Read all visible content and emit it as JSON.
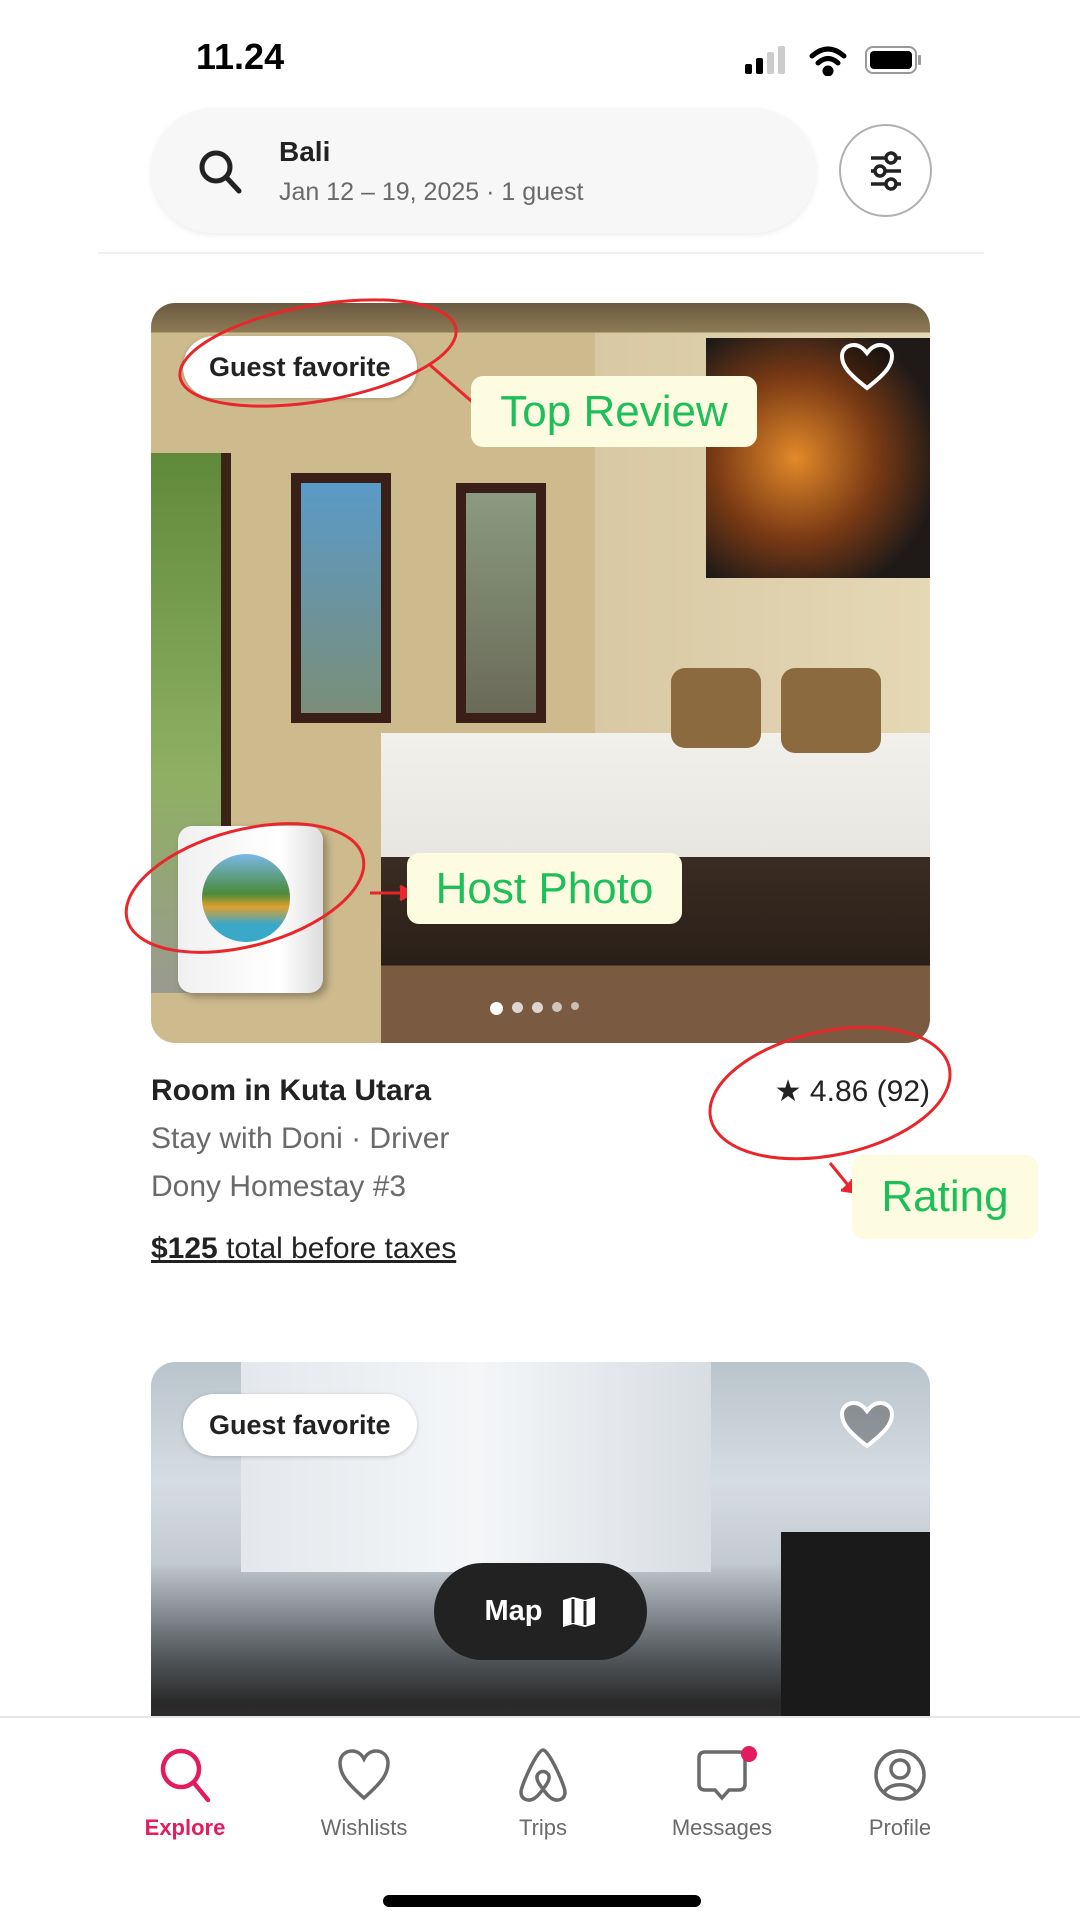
{
  "status_bar": {
    "time": "11.24"
  },
  "search": {
    "location": "Bali",
    "details": "Jan 12 – 19, 2025 · 1 guest"
  },
  "listings": [
    {
      "badge": "Guest favorite",
      "title": "Room in Kuta Utara",
      "rating": "4.86 (92)",
      "host_line": "Stay with Doni · Driver",
      "name": "Dony Homestay #3",
      "price": "$125",
      "price_suffix": " total before taxes",
      "photo_count": 5,
      "active_photo": 1
    },
    {
      "badge": "Guest favorite"
    }
  ],
  "annotations": {
    "top_review": "Top Review",
    "host_photo": "Host Photo",
    "rating": "Rating",
    "annotation_color": "#e8262b",
    "label_color": "#1dbf5a"
  },
  "map_button": {
    "label": "Map"
  },
  "tabs": [
    {
      "label": "Explore",
      "icon": "search-icon",
      "active": true
    },
    {
      "label": "Wishlists",
      "icon": "heart-icon"
    },
    {
      "label": "Trips",
      "icon": "airbnb-logo-icon"
    },
    {
      "label": "Messages",
      "icon": "message-icon",
      "badge_dot": true
    },
    {
      "label": "Profile",
      "icon": "profile-icon"
    }
  ],
  "colors": {
    "accent": "#e31c5f"
  }
}
